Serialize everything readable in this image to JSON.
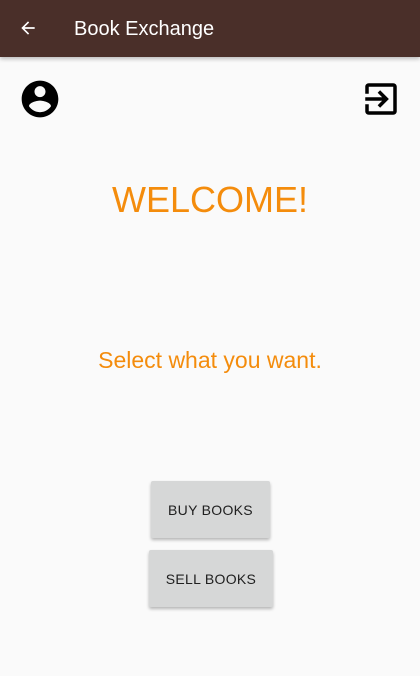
{
  "app_bar": {
    "title": "Book Exchange",
    "back_icon": "arrow-back-icon",
    "background": "#4a2f29"
  },
  "header_icons": {
    "profile_icon": "account-circle-icon",
    "logout_icon": "exit-to-app-icon"
  },
  "main": {
    "welcome": "WELCOME!",
    "prompt": "Select what you want.",
    "accent_color": "#f48c0c"
  },
  "actions": {
    "buy_label": "BUY BOOKS",
    "sell_label": "SELL BOOKS"
  }
}
